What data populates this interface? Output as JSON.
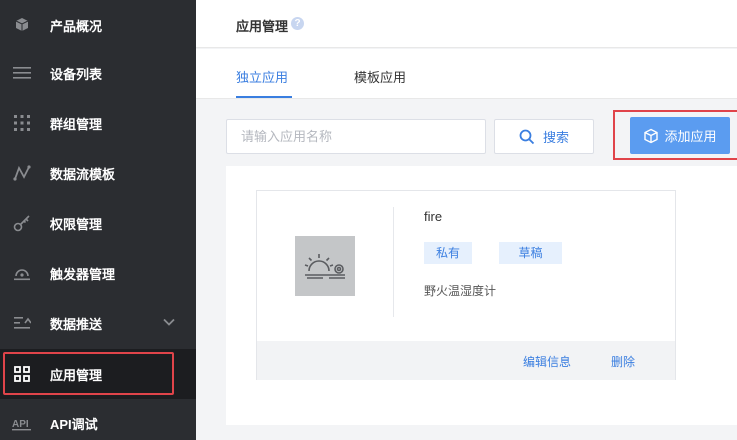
{
  "sidebar": {
    "items": [
      {
        "label": "产品概况",
        "icon": "cube-icon"
      },
      {
        "label": "设备列表",
        "icon": "list-icon"
      },
      {
        "label": "群组管理",
        "icon": "grid-dots-icon"
      },
      {
        "label": "数据流模板",
        "icon": "flow-icon"
      },
      {
        "label": "权限管理",
        "icon": "key-icon"
      },
      {
        "label": "触发器管理",
        "icon": "trigger-icon"
      },
      {
        "label": "数据推送",
        "icon": "push-icon"
      },
      {
        "label": "应用管理",
        "icon": "apps-icon"
      },
      {
        "label": "API调试",
        "icon": "api-icon"
      }
    ]
  },
  "header": {
    "title": "应用管理",
    "help": "?"
  },
  "tabs": [
    {
      "label": "独立应用",
      "active": true
    },
    {
      "label": "模板应用",
      "active": false
    }
  ],
  "toolbar": {
    "search_placeholder": "请输入应用名称",
    "search_label": "搜索",
    "add_label": "添加应用"
  },
  "app_card": {
    "name": "fire",
    "tags": [
      "私有",
      "草稿"
    ],
    "description": "野火温湿度计",
    "actions": [
      "编辑信息",
      "删除"
    ]
  },
  "colors": {
    "accent": "#3a7ee0",
    "sidebar_bg": "#2b2d31",
    "highlight": "#e0444a",
    "add_button_bg": "#5b9cf0"
  }
}
